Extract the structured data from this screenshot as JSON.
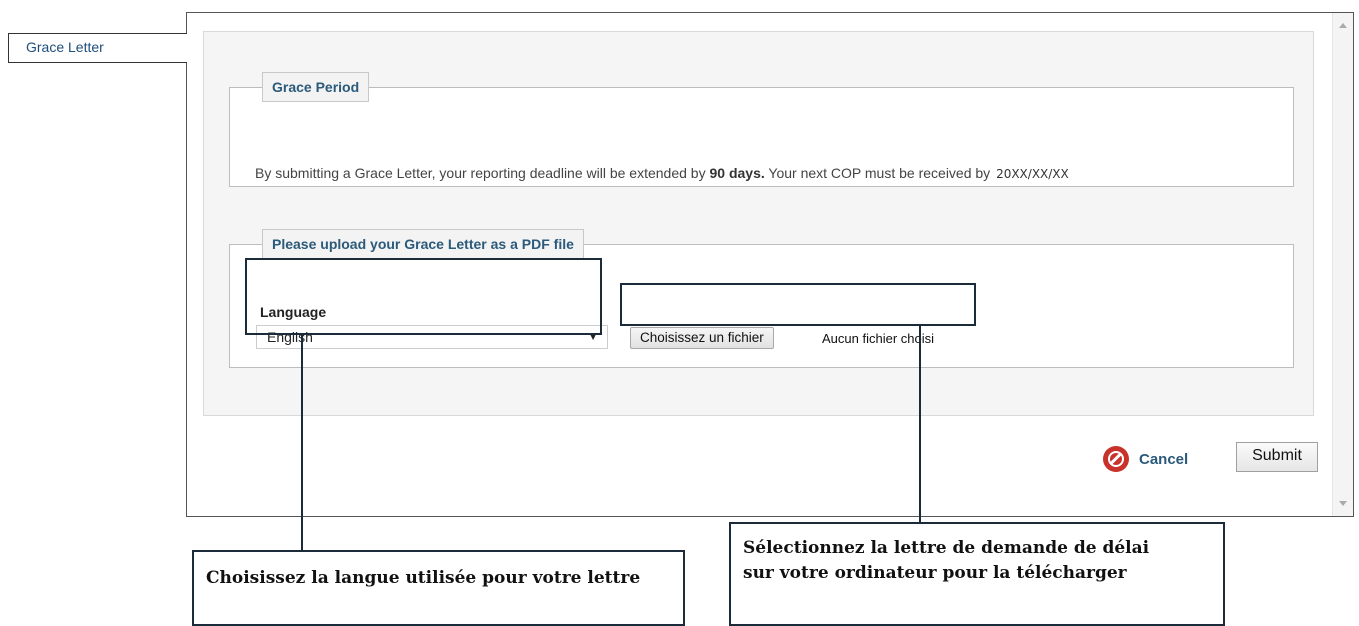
{
  "tab": {
    "label": "Grace Letter"
  },
  "grace_period": {
    "legend": "Grace Period",
    "text_before": "By submitting a Grace Letter, your reporting deadline will be extended by ",
    "days": "90 days.",
    "text_after": " Your next COP must be received by ",
    "date": "20XX/XX/XX"
  },
  "upload": {
    "legend": "Please upload your Grace Letter as a PDF file",
    "language_label": "Language",
    "language_value": "English",
    "file_button": "Choisissez un fichier",
    "file_status": "Aucun fichier choisi"
  },
  "actions": {
    "cancel": "Cancel",
    "submit": "Submit"
  },
  "annotations": {
    "language_note": "Choisissez la langue utilisée pour votre lettre",
    "file_note": "Sélectionnez la lettre de demande de délai sur votre ordinateur pour la télécharger"
  },
  "colors": {
    "accent": "#2b5a7a",
    "cancel_icon": "#c8322b",
    "callout": "#1c2b3a"
  }
}
